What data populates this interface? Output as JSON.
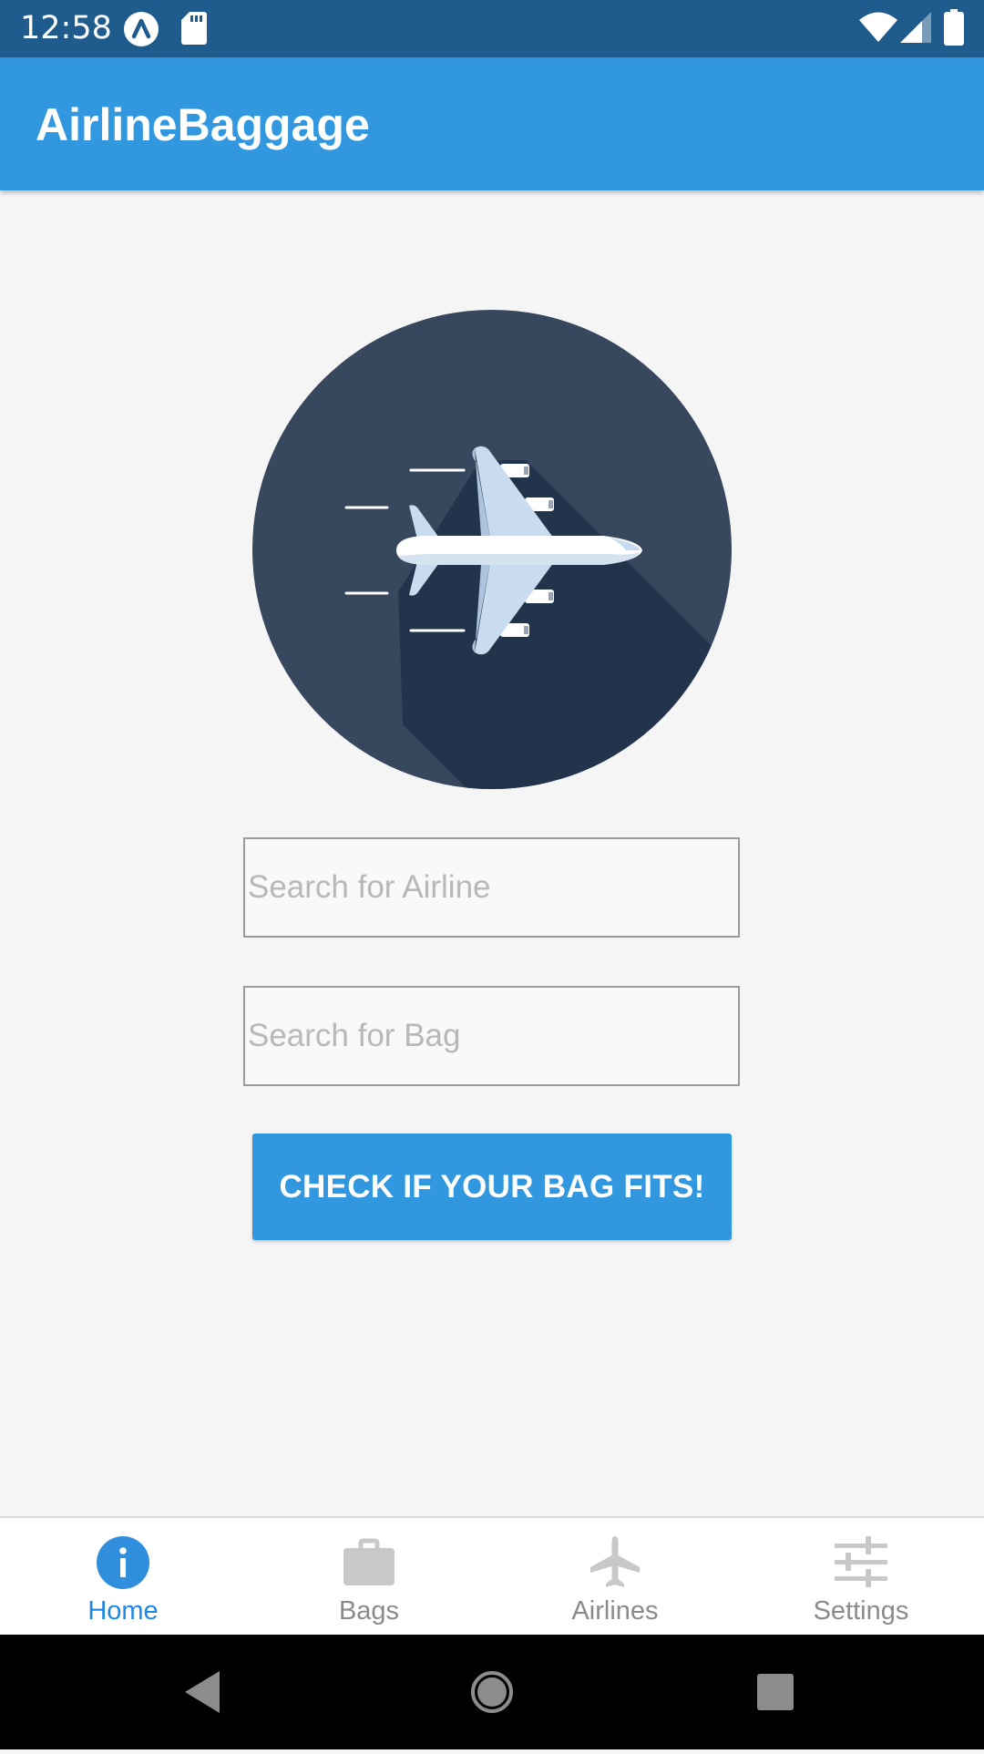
{
  "status_bar": {
    "time": "12:58",
    "left_icons": [
      "app-notification-icon",
      "sd-card-icon"
    ],
    "right_icons": [
      "wifi-icon",
      "cellular-signal-icon",
      "battery-icon"
    ]
  },
  "app_bar": {
    "title": "AirlineBaggage"
  },
  "hero": {
    "icon": "airplane-icon",
    "circle_color": "#37475e",
    "shadow_color": "#22344c"
  },
  "form": {
    "airline_placeholder": "Search for Airline",
    "airline_value": "",
    "bag_placeholder": "Search for Bag",
    "bag_value": "",
    "check_button_label": "CHECK IF YOUR BAG FITS!"
  },
  "tabs": [
    {
      "label": "Home",
      "icon": "info-icon",
      "active": true
    },
    {
      "label": "Bags",
      "icon": "briefcase-icon",
      "active": false
    },
    {
      "label": "Airlines",
      "icon": "airplane-icon",
      "active": false
    },
    {
      "label": "Settings",
      "icon": "sliders-icon",
      "active": false
    }
  ],
  "colors": {
    "status_bar": "#1f5b8c",
    "accent": "#3197df",
    "active_tab": "#1e88e5",
    "inactive_tab": "#8b8b8b",
    "background": "#f5f5f5"
  },
  "nav_bar": {
    "buttons": [
      "back-icon",
      "home-icon",
      "recents-icon"
    ]
  }
}
